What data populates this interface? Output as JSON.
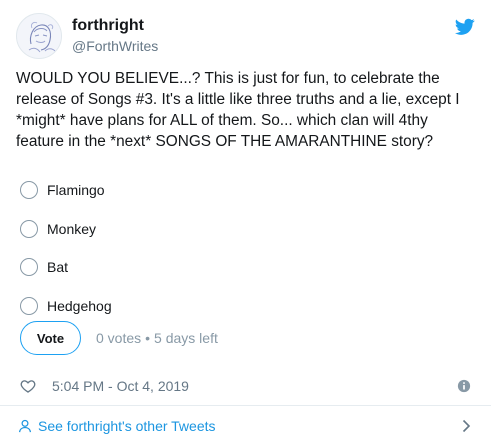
{
  "user": {
    "display_name": "forthright",
    "handle": "@ForthWrites"
  },
  "tweet": {
    "text": "WOULD YOU BELIEVE...? This is just for fun, to celebrate the release of Songs #3. It's a little like three truths and a lie, except I *might* have plans for ALL of them. So... which clan will 4thy feature in the *next* SONGS OF THE AMARANTHINE story?"
  },
  "poll": {
    "options": [
      "Flamingo",
      "Monkey",
      "Bat",
      "Hedgehog"
    ],
    "vote_label": "Vote",
    "votes": "0 votes",
    "separator": "•",
    "time_left": "5 days left"
  },
  "footer": {
    "timestamp": "5:04 PM - Oct 4, 2019"
  },
  "other_tweets": {
    "label": "See forthright's other Tweets"
  },
  "colors": {
    "accent": "#1da1f2",
    "link": "#1b95e0",
    "muted": "#657786"
  },
  "icons": [
    "twitter-bird-icon",
    "heart-icon",
    "info-icon",
    "person-icon",
    "chevron-right-icon"
  ]
}
